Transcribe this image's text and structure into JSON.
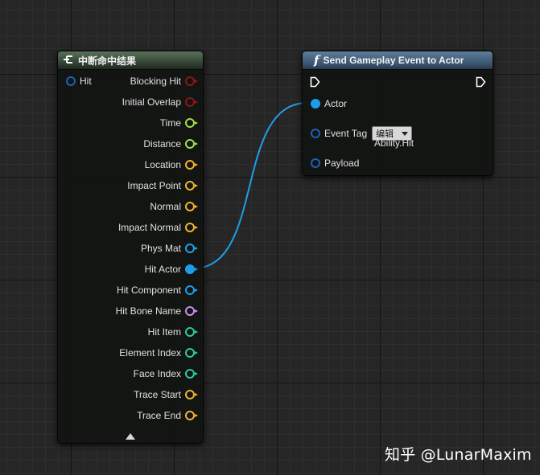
{
  "break_node": {
    "title": "中断命中结果",
    "input_pin": "Hit",
    "output_pins": [
      {
        "label": "Blocking Hit",
        "color": "#8a1616"
      },
      {
        "label": "Initial Overlap",
        "color": "#8a1616"
      },
      {
        "label": "Time",
        "color": "#9ee04a"
      },
      {
        "label": "Distance",
        "color": "#9ee04a"
      },
      {
        "label": "Location",
        "color": "#f2b233"
      },
      {
        "label": "Impact Point",
        "color": "#f2b233"
      },
      {
        "label": "Normal",
        "color": "#f2b233"
      },
      {
        "label": "Impact Normal",
        "color": "#f2b233"
      },
      {
        "label": "Phys Mat",
        "color": "#1f9ee8"
      },
      {
        "label": "Hit Actor",
        "color": "#1f9ee8"
      },
      {
        "label": "Hit Component",
        "color": "#1f9ee8"
      },
      {
        "label": "Hit Bone Name",
        "color": "#c88ef2"
      },
      {
        "label": "Hit Item",
        "color": "#2ec8a2"
      },
      {
        "label": "Element Index",
        "color": "#2ec8a2"
      },
      {
        "label": "Face Index",
        "color": "#2ec8a2"
      },
      {
        "label": "Trace Start",
        "color": "#f2b233"
      },
      {
        "label": "Trace End",
        "color": "#f2b233"
      }
    ]
  },
  "send_node": {
    "title": "Send Gameplay Event to Actor",
    "icon": "function-icon",
    "inputs": {
      "actor": "Actor",
      "event_tag": "Event Tag",
      "payload": "Payload"
    },
    "tag_dropdown": "编辑",
    "tag_value": "Ability.Hit"
  },
  "colors": {
    "object_pin": "#1f9ee8",
    "struct_pin": "#1f5fb8",
    "wire": "#1f9ee8"
  },
  "watermark": "知乎 @LunarMaxim"
}
